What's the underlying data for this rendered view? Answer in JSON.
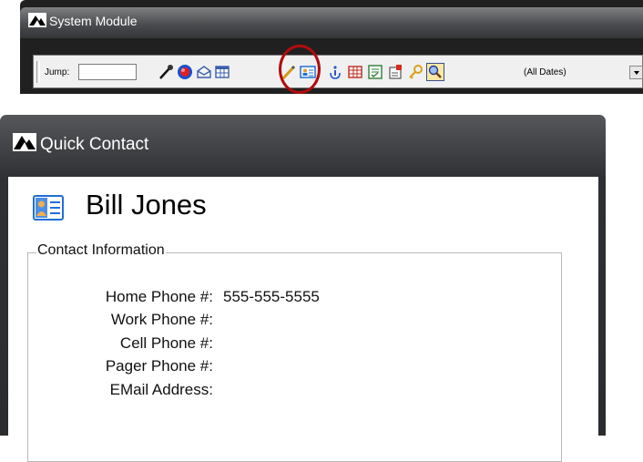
{
  "system_window": {
    "title": "System Module",
    "logo_icon": "mountain-logo-icon",
    "toolbar": {
      "jump_label": "Jump:",
      "jump_value": "",
      "icons": [
        "pen-icon",
        "globe-icon",
        "envelope-icon",
        "grid-icon",
        "pencil-icon",
        "contact-card-icon",
        "info-icon",
        "table-icon",
        "checklist-icon",
        "notepad-icon",
        "key-icon",
        "search-icon"
      ],
      "highlighted_icon": "contact-card-icon",
      "date_filter": "(All Dates)"
    }
  },
  "quick_contact": {
    "title": "Quick Contact",
    "logo_icon": "mountain-logo-icon",
    "contact_icon": "contact-card-icon",
    "name": "Bill Jones",
    "section_title": "Contact Information",
    "fields": [
      {
        "label": "Home Phone #:",
        "value": "555-555-5555"
      },
      {
        "label": "Work Phone #:",
        "value": ""
      },
      {
        "label": "Cell Phone #:",
        "value": ""
      },
      {
        "label": "Pager Phone #:",
        "value": ""
      },
      {
        "label": "EMail Address:",
        "value": ""
      }
    ]
  },
  "colors": {
    "window_chrome": "#2e3033",
    "highlight_ring": "#b10c0c",
    "contact_icon_blue": "#1f6fd6"
  }
}
